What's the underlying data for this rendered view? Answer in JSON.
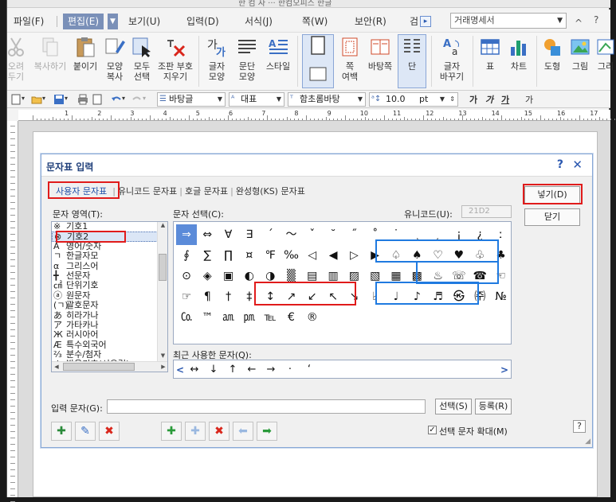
{
  "app": {
    "title_fragment": "한 컴 자 ··· 한컴오피스 한글",
    "menu": [
      {
        "label": "파일(F)",
        "active": false
      },
      {
        "label": "편집(E)",
        "active": true
      },
      {
        "label": "보기(U)",
        "active": false
      },
      {
        "label": "입력(D)",
        "active": false
      },
      {
        "label": "서식(J)",
        "active": false
      },
      {
        "label": "쪽(W)",
        "active": false
      },
      {
        "label": "보안(R)",
        "active": false
      },
      {
        "label": "검",
        "active": false
      }
    ],
    "doc_type": "거래명세서"
  },
  "ribbon": [
    {
      "label": "오려\n두기",
      "icon": "scissors-icon",
      "disabled": true
    },
    {
      "label": "복사하기",
      "icon": "copy-icon",
      "disabled": true
    },
    {
      "label": "붙이기",
      "icon": "paste-icon",
      "disabled": false
    },
    {
      "label": "모양\n복사",
      "icon": "format-painter-icon",
      "disabled": false
    },
    {
      "label": "모두\n선택",
      "icon": "select-all-icon",
      "disabled": false
    },
    {
      "label": "조판 부호\n지우기",
      "icon": "clear-codes-icon",
      "disabled": false
    },
    {
      "label": "글자\n모양",
      "icon": "char-shape-icon",
      "disabled": false
    },
    {
      "label": "문단\n모양",
      "icon": "para-shape-icon",
      "disabled": false
    },
    {
      "label": "스타일",
      "icon": "style-icon",
      "disabled": false
    },
    {
      "label": "",
      "icon": "page-icon",
      "disabled": false
    },
    {
      "label": "쪽\n여백",
      "icon": "page-margin-icon",
      "disabled": false
    },
    {
      "label": "바탕쪽",
      "icon": "master-page-icon",
      "disabled": false
    },
    {
      "label": "단",
      "icon": "columns-icon",
      "disabled": false
    },
    {
      "label": "글자\n바꾸기",
      "icon": "replace-char-icon",
      "disabled": false
    },
    {
      "label": "표",
      "icon": "table-icon",
      "disabled": false
    },
    {
      "label": "차트",
      "icon": "chart-icon",
      "disabled": false
    },
    {
      "label": "도형",
      "icon": "shape-icon",
      "disabled": false
    },
    {
      "label": "그림",
      "icon": "picture-icon",
      "disabled": false
    },
    {
      "label": "그리",
      "icon": "draw-icon",
      "disabled": false
    }
  ],
  "toolbar": {
    "style": "바탕글",
    "lang": "대표",
    "font": "함초롬바탕",
    "size": "10.0",
    "unit": "pt",
    "bold": "가",
    "italic": "가",
    "underline": "가",
    "more": "가"
  },
  "ruler": {
    "numbers": [
      "1",
      "2",
      "3",
      "4",
      "5",
      "6",
      "7",
      "8",
      "9",
      "10",
      "11",
      "12",
      "13",
      "14",
      "15",
      "16",
      "17"
    ]
  },
  "dialog": {
    "title": "문자표 입력",
    "help": "?",
    "close": "✕",
    "tabs": [
      "사용자 문자표",
      "유니코드 문자표",
      "호글 문자표",
      "완성형(KS) 문자표"
    ],
    "area_label": "문자 영역(T):",
    "char_label": "문자 선택(C):",
    "unicode_label": "유니코드(U):",
    "unicode_value": "21D2",
    "recent_label": "최근 사용한 문자(Q):",
    "input_label": "입력 문자(G):",
    "input_value": "",
    "insert_btn": "넣기(D)",
    "close_btn": "닫기",
    "select_btn": "선택(S)",
    "register_btn": "등록(R)",
    "enlarge_label": "선택 문자 확대(M)",
    "enlarge_checked": "✓",
    "help_btn": "?",
    "areas": [
      {
        "sym": "※",
        "label": "기호1"
      },
      {
        "sym": "⊗",
        "label": "기호2"
      },
      {
        "sym": "A",
        "label": "영어/숫자"
      },
      {
        "sym": "ㄱ",
        "label": "한글자모"
      },
      {
        "sym": "α",
        "label": "그리스어"
      },
      {
        "sym": "╋",
        "label": "선문자"
      },
      {
        "sym": "㎠",
        "label": "단위기호"
      },
      {
        "sym": "ⓐ",
        "label": "원문자"
      },
      {
        "sym": "(ㄱ)",
        "label": "괄호문자"
      },
      {
        "sym": "あ",
        "label": "히라가나"
      },
      {
        "sym": "ア",
        "label": "가타카나"
      },
      {
        "sym": "Ж",
        "label": "러시아어"
      },
      {
        "sym": "Æ",
        "label": "특수외국어"
      },
      {
        "sym": "⅔",
        "label": "분수/첨자"
      },
      {
        "sym": "ʤ",
        "label": "발음기호(서유럽)"
      }
    ],
    "grid": [
      [
        "⇒",
        "⇔",
        "∀",
        "∃",
        "´",
        "～",
        "ˇ",
        "˘",
        "˝",
        "˚",
        "˙",
        "¸",
        "˛",
        "¡",
        "¿",
        "ː"
      ],
      [
        "∮",
        "∑",
        "∏",
        "¤",
        "℉",
        "‰",
        "◁",
        "◀",
        "▷",
        "▶",
        "♤",
        "♠",
        "♡",
        "♥",
        "♧",
        "♣"
      ],
      [
        "⊙",
        "◈",
        "▣",
        "◐",
        "◑",
        "▒",
        "▤",
        "▥",
        "▨",
        "▧",
        "▦",
        "▩",
        "♨",
        "☏",
        "☎",
        "☜"
      ],
      [
        "☞",
        "¶",
        "†",
        "‡",
        "↕",
        "↗",
        "↙",
        "↖",
        "↘",
        "♭",
        "♩",
        "♪",
        "♬",
        "㉿",
        "㈜",
        "№"
      ],
      [
        "㏇",
        "™",
        "㏂",
        "㏘",
        "℡",
        "€",
        "®"
      ]
    ],
    "recent": [
      "↔",
      "↓",
      "↑",
      "←",
      "→",
      "·",
      "‘"
    ],
    "bottom_icons": [
      "add-char-icon",
      "edit-char-icon",
      "delete-char-icon",
      "add-icon",
      "add-sub-icon",
      "delete-icon",
      "left-arrow-icon",
      "right-arrow-icon"
    ]
  }
}
